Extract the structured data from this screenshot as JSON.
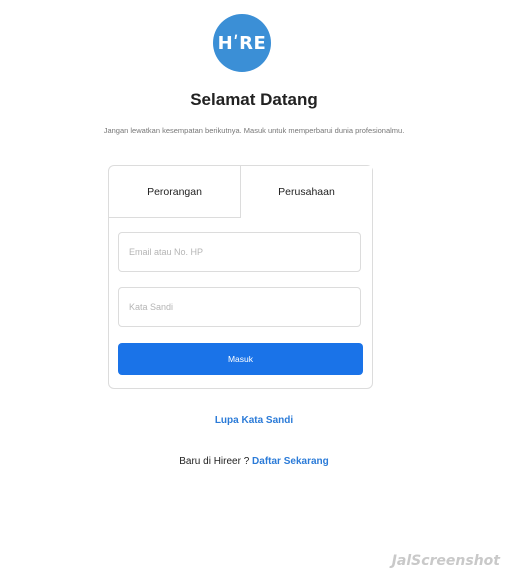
{
  "logo": {
    "text": "HʹRE",
    "color": "#3b8fd6"
  },
  "header": {
    "title": "Selamat Datang",
    "subtitle": "Jangan lewatkan kesempatan berikutnya. Masuk untuk memperbarui dunia profesionalmu."
  },
  "login_card": {
    "tabs": [
      {
        "label": "Perorangan",
        "active": false
      },
      {
        "label": "Perusahaan",
        "active": true
      }
    ],
    "email_placeholder": "Email atau No. HP",
    "password_placeholder": "Kata Sandi",
    "submit_label": "Masuk",
    "submit_color": "#1a73e8"
  },
  "forgot_password": "Lupa Kata Sandi",
  "register": {
    "prompt": "Baru di Hireer ?",
    "link": "Daftar Sekarang"
  },
  "watermark": "JalScreenshot"
}
